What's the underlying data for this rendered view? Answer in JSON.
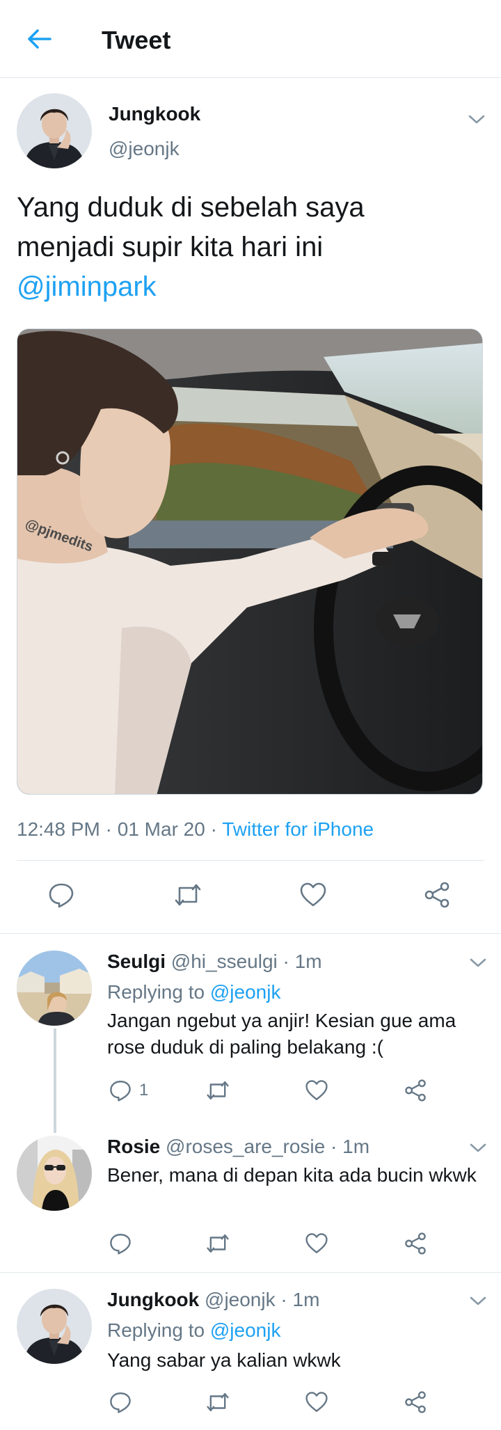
{
  "header": {
    "title": "Tweet"
  },
  "main_tweet": {
    "name": "Jungkook",
    "handle": "@jeonjk",
    "text_line1": "Yang duduk di sebelah saya",
    "text_line2": "menjadi supir kita hari ini",
    "mention": "@jiminpark",
    "time": "12:48 PM",
    "date": "01 Mar 20",
    "source": "Twitter for iPhone",
    "media_watermark": "@pjmedits"
  },
  "replies": [
    {
      "name": "Seulgi",
      "handle": "@hi_sseulgi",
      "time": "1m",
      "replying_prefix": "Replying to",
      "replying_to": "@jeonjk",
      "text": "Jangan ngebut ya anjir! Kesian gue ama rose duduk di paling belakang :(",
      "reply_count": "1"
    },
    {
      "name": "Rosie",
      "handle": "@roses_are_rosie",
      "time": "1m",
      "text": "Bener, mana di depan kita ada bucin wkwk"
    },
    {
      "name": "Jungkook",
      "handle": "@jeonjk",
      "time": "1m",
      "replying_prefix": "Replying to",
      "replying_to": "@jeonjk",
      "text": "Yang sabar ya kalian wkwk"
    }
  ],
  "icons": {
    "back": "arrow-left-icon",
    "reply": "reply-icon",
    "retweet": "retweet-icon",
    "like": "heart-icon",
    "share": "share-icon",
    "more": "chevron-down-icon"
  },
  "colors": {
    "accent": "#1da1f2",
    "muted": "#657786",
    "text": "#14171a",
    "divider": "#e1e8ed"
  }
}
